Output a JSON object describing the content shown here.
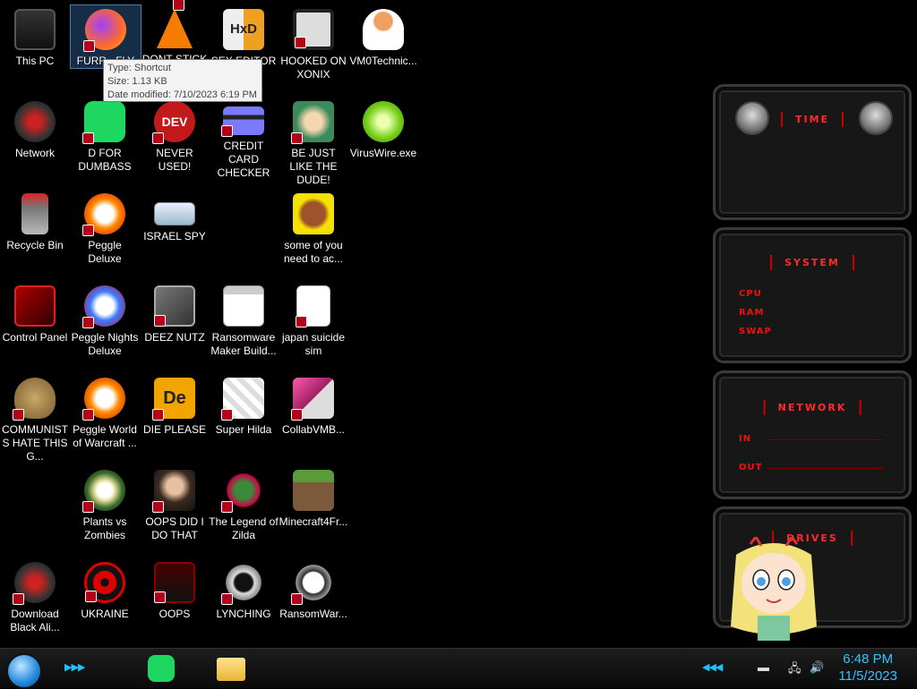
{
  "desktop": {
    "icons": [
      {
        "label": "This PC"
      },
      {
        "label": "FURR...FLY"
      },
      {
        "label": "DONT STICK"
      },
      {
        "label": "SEX EDITOR"
      },
      {
        "label": "HOOKED ON XONIX"
      },
      {
        "label": "VM0Technic..."
      },
      {
        "label": "Network"
      },
      {
        "label": "D FOR DUMBASS"
      },
      {
        "label": "NEVER USED!"
      },
      {
        "label": "CREDIT CARD CHECKER"
      },
      {
        "label": "BE JUST LIKE THE DUDE!"
      },
      {
        "label": "VirusWire.exe"
      },
      {
        "label": "Recycle Bin"
      },
      {
        "label": "Peggle Deluxe"
      },
      {
        "label": "ISRAEL SPY"
      },
      {
        "label": "some of you need to ac..."
      },
      {
        "label": "Control Panel"
      },
      {
        "label": "Peggle Nights Deluxe"
      },
      {
        "label": "DEEZ NUTZ"
      },
      {
        "label": "Ransomware Maker Build..."
      },
      {
        "label": "japan suicide sim"
      },
      {
        "label": "COMMUNISTS HATE THIS G..."
      },
      {
        "label": "Peggle World of Warcraft ..."
      },
      {
        "label": "DIE PLEASE"
      },
      {
        "label": "Super Hilda"
      },
      {
        "label": "CollabVMB..."
      },
      {
        "label": "Plants vs Zombies"
      },
      {
        "label": "OOPS DID I DO THAT"
      },
      {
        "label": "The Legend of Zilda"
      },
      {
        "label": "Minecraft4Fr..."
      },
      {
        "label": "Download Black Ali..."
      },
      {
        "label": "UKRAINE"
      },
      {
        "label": "OOPS"
      },
      {
        "label": "LYNCHING"
      },
      {
        "label": "RansomWar..."
      }
    ]
  },
  "tooltip": {
    "type": "Type: Shortcut",
    "size": "Size: 1.13 KB",
    "date": "Date modified: 7/10/2023 6:19 PM"
  },
  "gadget": {
    "time_title": "TIME",
    "system_title": "SYSTEM",
    "cpu": "CPU",
    "ram": "RAM",
    "swap": "SWAP",
    "network_title": "NETWORK",
    "in": "IN",
    "out": "OUT",
    "drives_title": "DRIVES"
  },
  "taskbar": {
    "time": "6:48 PM",
    "date": "11/5/2023",
    "accent": "#19c3ff"
  }
}
